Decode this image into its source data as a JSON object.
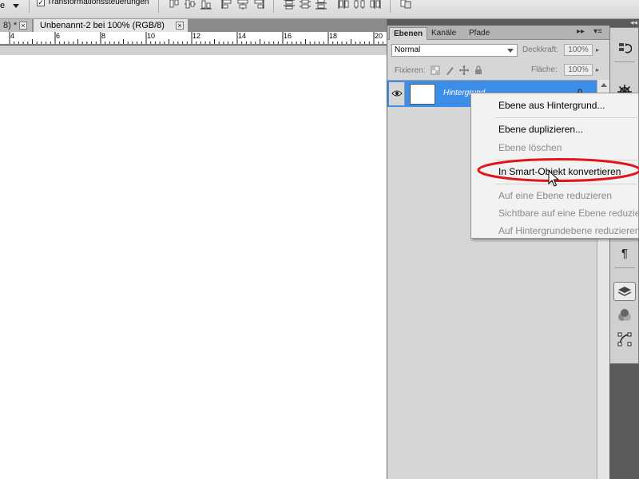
{
  "options_bar": {
    "select_fragment": "e",
    "checkbox_checked": true,
    "checkbox_label": "Transformationssteuerungen"
  },
  "doc_tabs": [
    {
      "label": "8) *",
      "active": false
    },
    {
      "label": "Unbenannt-2 bei 100% (RGB/8)",
      "active": true
    }
  ],
  "ruler": {
    "ticks": [
      "4",
      "6",
      "8",
      "10",
      "12",
      "14",
      "16",
      "18",
      "20"
    ]
  },
  "layers_panel": {
    "tabs": [
      "Ebenen",
      "Kanäle",
      "Pfade"
    ],
    "active_tab": "Ebenen",
    "collapse_label": "▸▸",
    "menu_label": "▾≡",
    "blend_mode": "Normal",
    "opacity_label": "Deckkraft:",
    "opacity_value": "100%",
    "lock_label": "Fixieren:",
    "fill_label": "Fläche:",
    "fill_value": "100%",
    "layers": [
      {
        "name": "Hintergrund",
        "visible": true,
        "locked": true,
        "selected": true
      }
    ]
  },
  "dock": {
    "collapse_label": "◂◂"
  },
  "context_menu": {
    "items": [
      {
        "label": "Ebene aus Hintergrund...",
        "enabled": true
      },
      {
        "label": "Ebene duplizieren...",
        "enabled": true
      },
      {
        "label": "Ebene löschen",
        "enabled": false
      },
      {
        "label": "In Smart-Objekt konvertieren",
        "enabled": true,
        "highlighted": true
      },
      {
        "label": "Auf eine Ebene reduzieren",
        "enabled": false
      },
      {
        "label": "Sichtbare auf eine Ebene reduzieren",
        "enabled": false
      },
      {
        "label": "Auf Hintergrundebene reduzieren",
        "enabled": false
      }
    ]
  },
  "colors": {
    "selection_blue": "#3d8ee8",
    "highlight_oval": "#e0161d",
    "panel_gray": "#d6d6d6",
    "workspace_gray": "#5a5a5a"
  }
}
